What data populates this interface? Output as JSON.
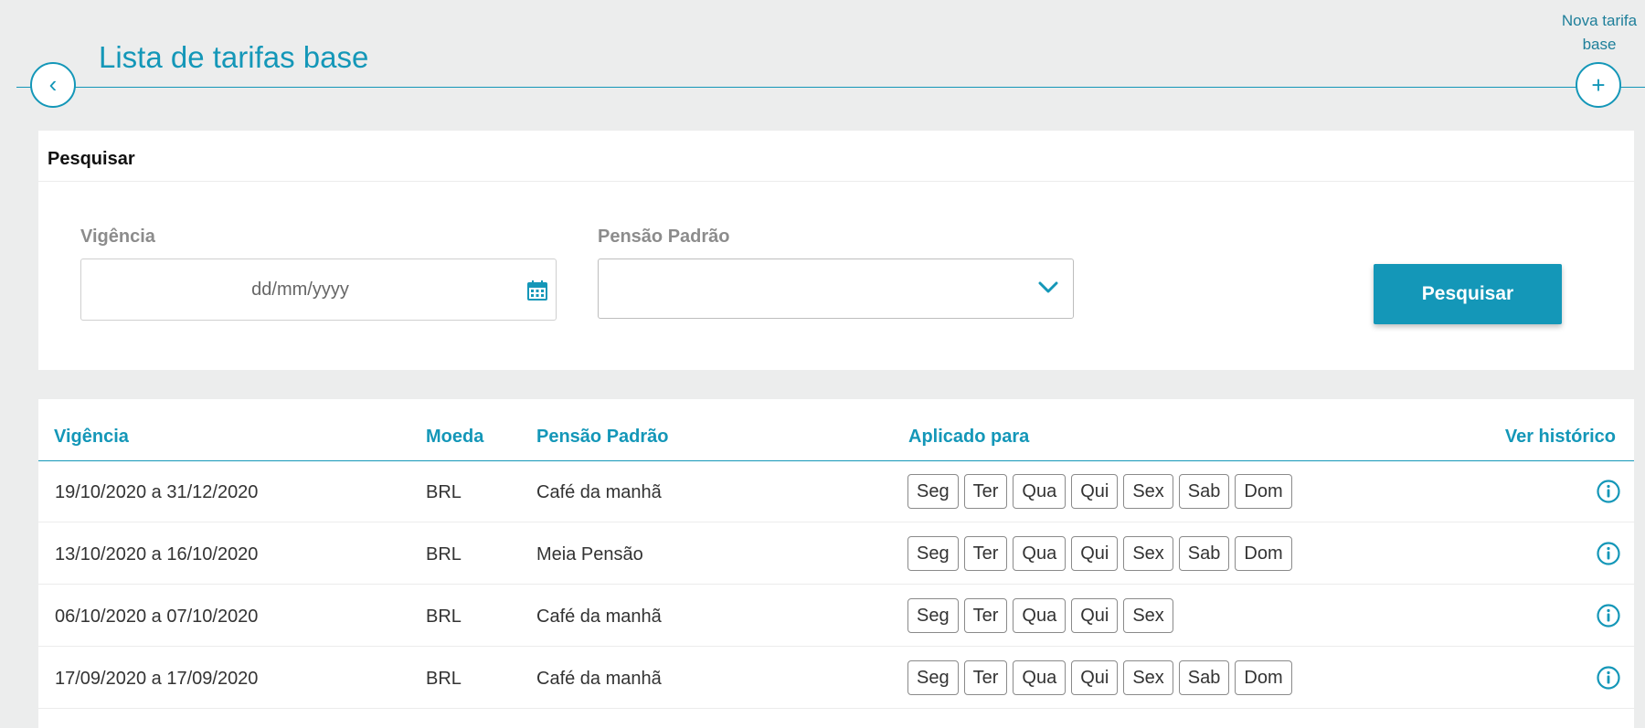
{
  "header": {
    "title": "Lista de tarifas base",
    "new_label": "Nova tarifa base",
    "back_symbol": "‹",
    "add_symbol": "+"
  },
  "search": {
    "title": "Pesquisar",
    "vigencia_label": "Vigência",
    "date_placeholder": "dd/mm/yyyy",
    "pensao_label": "Pensão Padrão",
    "pensao_value": "",
    "button_label": "Pesquisar"
  },
  "table": {
    "headers": [
      "Vigência",
      "Moeda",
      "Pensão Padrão",
      "Aplicado para",
      "Ver histórico"
    ],
    "rows": [
      {
        "vigencia": "19/10/2020 a 31/12/2020",
        "moeda": "BRL",
        "pensao": "Café da manhã",
        "dias": [
          "Seg",
          "Ter",
          "Qua",
          "Qui",
          "Sex",
          "Sab",
          "Dom"
        ]
      },
      {
        "vigencia": "13/10/2020 a 16/10/2020",
        "moeda": "BRL",
        "pensao": "Meia Pensão",
        "dias": [
          "Seg",
          "Ter",
          "Qua",
          "Qui",
          "Sex",
          "Sab",
          "Dom"
        ]
      },
      {
        "vigencia": "06/10/2020 a 07/10/2020",
        "moeda": "BRL",
        "pensao": "Café da manhã",
        "dias": [
          "Seg",
          "Ter",
          "Qua",
          "Qui",
          "Sex"
        ]
      },
      {
        "vigencia": "17/09/2020 a 17/09/2020",
        "moeda": "BRL",
        "pensao": "Café da manhã",
        "dias": [
          "Seg",
          "Ter",
          "Qua",
          "Qui",
          "Sex",
          "Sab",
          "Dom"
        ]
      }
    ]
  },
  "icons": {
    "back": "chevron-left-icon",
    "add": "plus-icon",
    "calendar": "calendar-icon",
    "dropdown": "chevron-down-icon",
    "history": "info-icon"
  },
  "colors": {
    "accent": "#1497b8",
    "background": "#eceded"
  }
}
